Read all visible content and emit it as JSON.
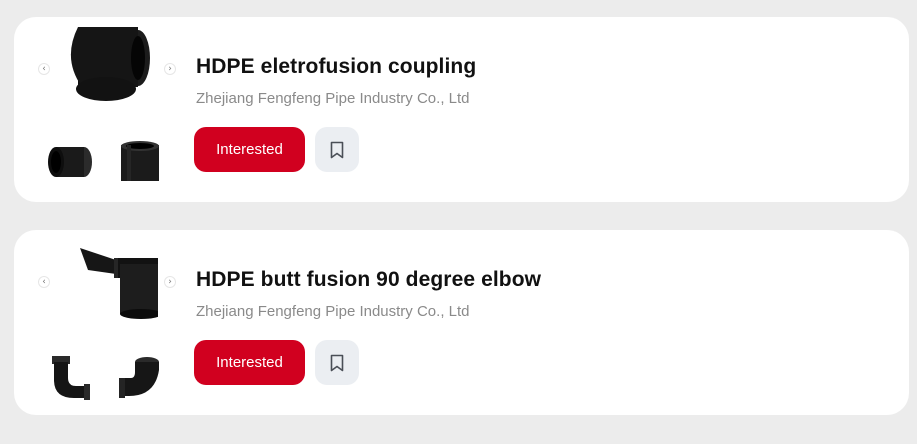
{
  "products": [
    {
      "title": "HDPE eletrofusion coupling",
      "company": "Zhejiang Fengfeng Pipe Industry Co., Ltd",
      "interested_label": "Interested",
      "bookmark_icon": "bookmark-icon",
      "prev_icon": "chevron-left-icon",
      "next_icon": "chevron-right-icon",
      "prev_glyph": "‹",
      "next_glyph": "›"
    },
    {
      "title": "HDPE butt fusion 90 degree elbow",
      "company": "Zhejiang Fengfeng Pipe Industry Co., Ltd",
      "interested_label": "Interested",
      "bookmark_icon": "bookmark-icon",
      "prev_icon": "chevron-left-icon",
      "next_icon": "chevron-right-icon",
      "prev_glyph": "‹",
      "next_glyph": "›"
    }
  ],
  "colors": {
    "page_background": "#ececec",
    "card_background": "#ffffff",
    "accent_red": "#d1001f",
    "bookmark_button_bg": "#ebeef2",
    "company_text": "#8a8a8a"
  }
}
